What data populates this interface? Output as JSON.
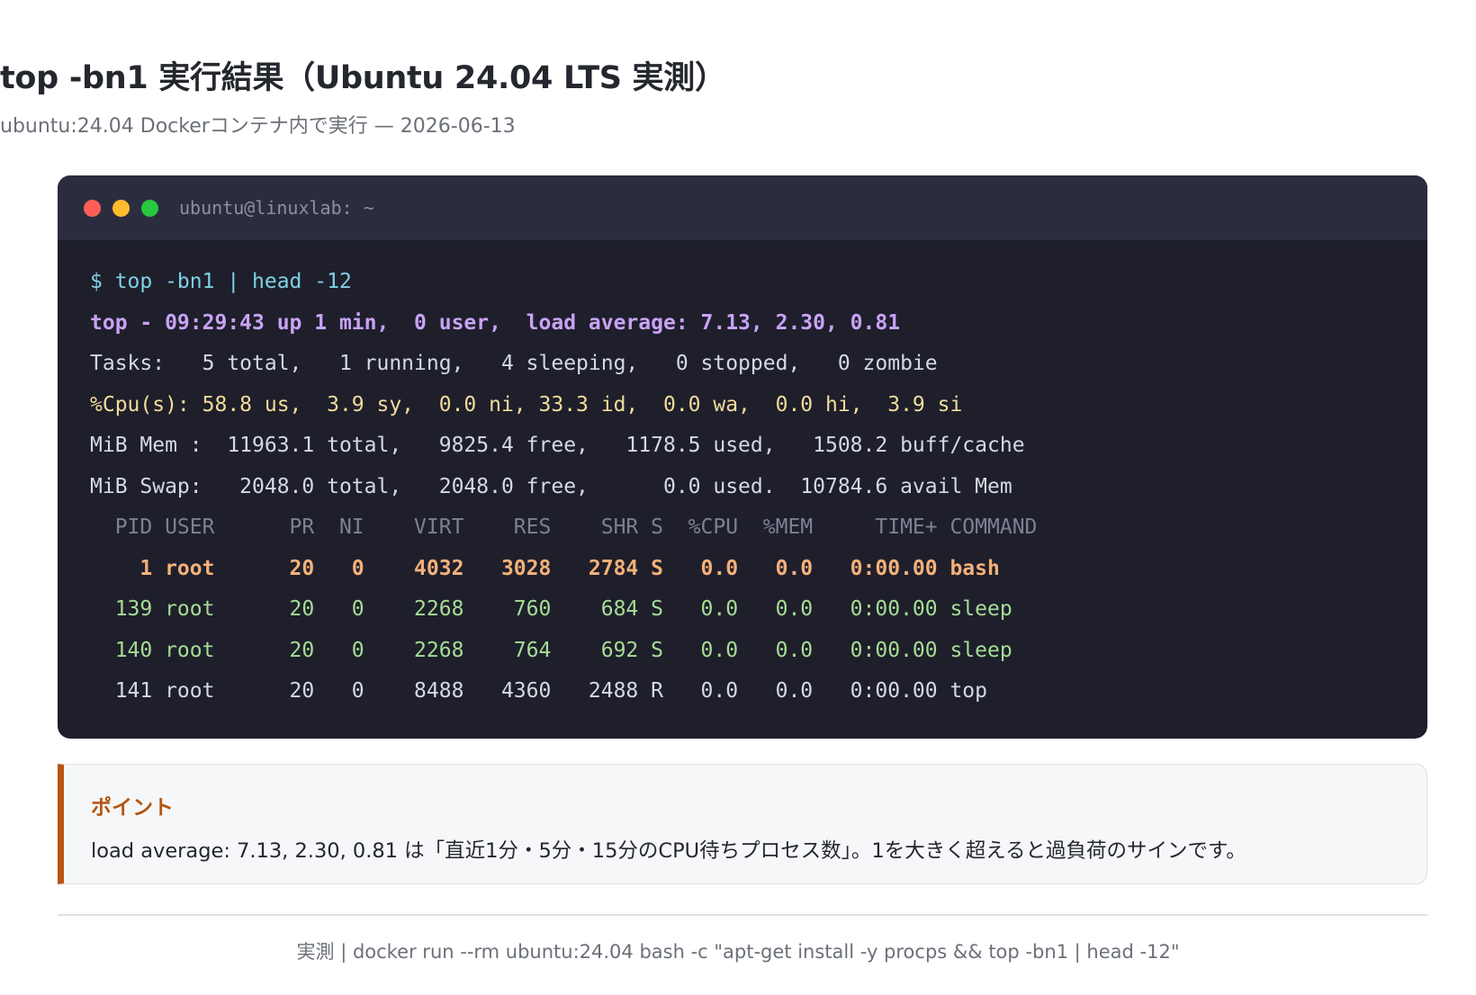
{
  "page": {
    "title": "top -bn1 実行結果（Ubuntu 24.04 LTS 実測）",
    "subtitle": "ubuntu:24.04 Dockerコンテナ内で実行 — 2026-06-13"
  },
  "terminal": {
    "window_title": "ubuntu@linuxlab: ~",
    "command": "$ top -bn1 | head -12",
    "summary_line": "top - 09:29:43 up 1 min,  0 user,  load average: 7.13, 2.30, 0.81",
    "tasks_line": "Tasks:   5 total,   1 running,   4 sleeping,   0 stopped,   0 zombie",
    "cpu_line": "%Cpu(s): 58.8 us,  3.9 sy,  0.0 ni, 33.3 id,  0.0 wa,  0.0 hi,  3.9 si",
    "mem_line": "MiB Mem :  11963.1 total,   9825.4 free,   1178.5 used,   1508.2 buff/cache",
    "swap_line": "MiB Swap:   2048.0 total,   2048.0 free,      0.0 used.  10784.6 avail Mem",
    "process_header": "  PID USER      PR  NI    VIRT    RES    SHR S  %CPU  %MEM     TIME+ COMMAND",
    "processes": [
      "    1 root      20   0    4032   3028   2784 S   0.0   0.0   0:00.00 bash",
      "  139 root      20   0    2268    760    684 S   0.0   0.0   0:00.00 sleep",
      "  140 root      20   0    2268    764    692 S   0.0   0.0   0:00.00 sleep",
      "  141 root      20   0    8488   4360   2488 R   0.0   0.0   0:00.00 top"
    ]
  },
  "point": {
    "title": "ポイント",
    "text": "load average: 7.13, 2.30, 0.81 は「直近1分・5分・15分のCPU待ちプロセス数」。1を大きく超えると過負荷のサインです。"
  },
  "footer": {
    "text": "実測 | docker run --rm ubuntu:24.04 bash -c \"apt-get install -y procps && top -bn1 | head -12\""
  },
  "colors": {
    "accent": "#b5550f",
    "terminal_bg": "#1e1f2b",
    "titlebar_bg": "#2b2d3f",
    "prompt": "#7fd0e6",
    "summary": "#c9a2f5",
    "cpu": "#f3dc9a",
    "highlight_row": "#f5b07a",
    "sleep_row": "#a6dd95"
  }
}
